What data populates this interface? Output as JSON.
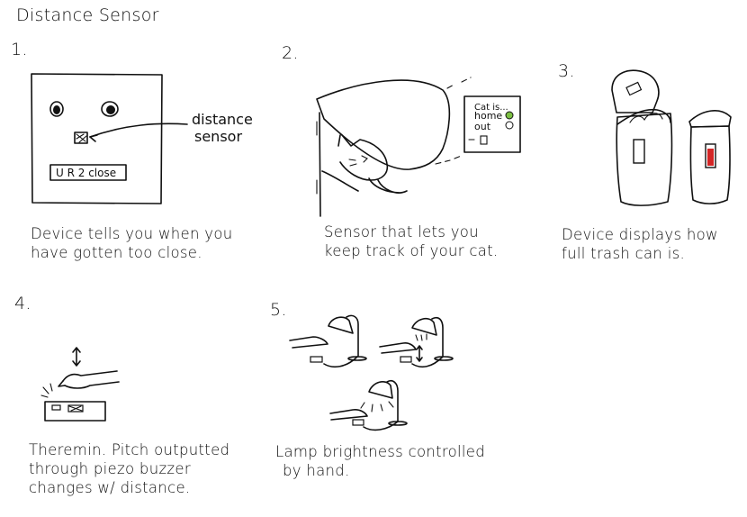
{
  "title": "Distance Sensor",
  "panels": [
    {
      "number": "1.",
      "caption_lines": [
        "Device tells you when you",
        "have gotten too close."
      ],
      "labels": {
        "sensor_line1": "distance",
        "sensor_line2": "sensor",
        "display": "U R 2 close"
      }
    },
    {
      "number": "2.",
      "caption_lines": [
        "Sensor that lets you",
        "keep track of your cat."
      ],
      "labels": {
        "status_title": "Cat is...",
        "status_home": "home",
        "status_out": "out"
      }
    },
    {
      "number": "3.",
      "caption_lines": [
        "Device displays how",
        "full trash can is."
      ]
    },
    {
      "number": "4.",
      "caption_lines": [
        "Theremin. Pitch outputted",
        "through piezo buzzer",
        "changes w/ distance."
      ]
    },
    {
      "number": "5.",
      "caption_lines": [
        "Lamp brightness controlled",
        "by hand."
      ]
    }
  ],
  "colors": {
    "ink": "#111111",
    "home_led": "#7cc043",
    "trash_indicator": "#d32626"
  }
}
